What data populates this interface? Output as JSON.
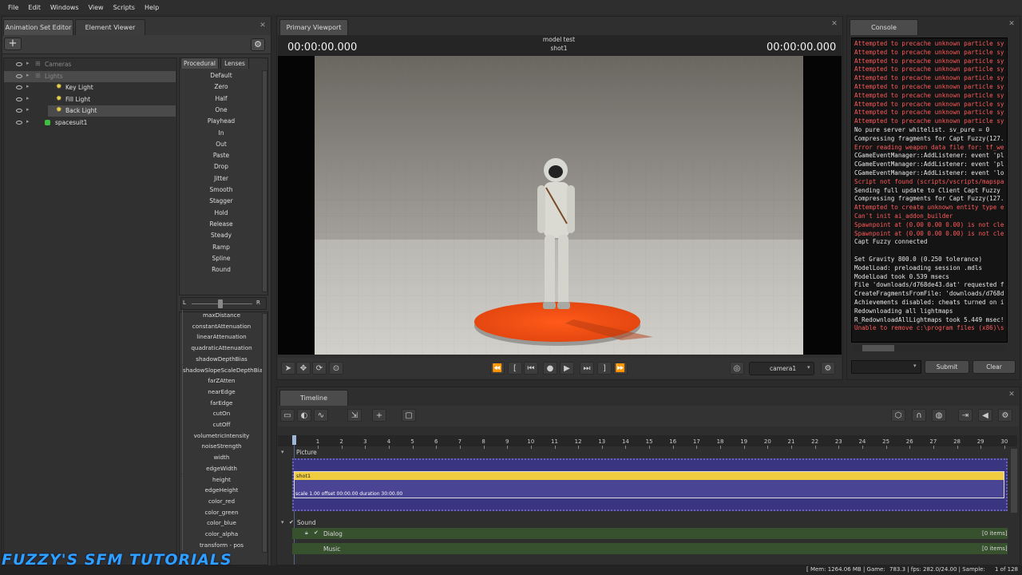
{
  "menu": [
    "File",
    "Edit",
    "Windows",
    "View",
    "Scripts",
    "Help"
  ],
  "left_panel": {
    "tabs": [
      "Animation Set Editor",
      "Element Viewer"
    ],
    "tree": [
      {
        "label": "Cameras",
        "indent": 0,
        "dim": true
      },
      {
        "label": "Lights",
        "indent": 0,
        "dim": true,
        "selected": true
      },
      {
        "label": "Key Light",
        "indent": 1
      },
      {
        "label": "Fill Light",
        "indent": 1
      },
      {
        "label": "Back Light",
        "indent": 1,
        "selected": true
      },
      {
        "label": "spacesuit1",
        "indent": 0
      }
    ],
    "sub_tabs": [
      "Procedural",
      "Lenses"
    ],
    "procedural": [
      "Default",
      "Zero",
      "Half",
      "One",
      "Playhead",
      "In",
      "Out",
      "Paste",
      "Drop",
      "Jitter",
      "Smooth",
      "Stagger",
      "Hold",
      "Release",
      "Steady",
      "Ramp",
      "Spline",
      "Round"
    ],
    "slider_left": "L",
    "slider_right": "R",
    "attributes": [
      "maxDistance",
      "constantAttenuation",
      "linearAttenuation",
      "quadraticAttenuation",
      "shadowDepthBias",
      "shadowSlopeScaleDepthBias",
      "farZAtten",
      "nearEdge",
      "farEdge",
      "cutOn",
      "cutOff",
      "volumetricIntensity",
      "noiseStrength",
      "width",
      "edgeWidth",
      "height",
      "edgeHeight",
      "color_red",
      "color_green",
      "color_blue",
      "color_alpha",
      "transform - pos"
    ]
  },
  "viewport": {
    "tab": "Primary Viewport",
    "time_left": "00:00:00.000",
    "time_right": "00:00:00.000",
    "title": "model test",
    "shot": "shot1",
    "camera": "camera1"
  },
  "console": {
    "tab": "Console",
    "lines": [
      {
        "t": "Attempted to precache unknown particle sy",
        "c": "red"
      },
      {
        "t": "Attempted to precache unknown particle sy",
        "c": "red"
      },
      {
        "t": "Attempted to precache unknown particle sy",
        "c": "red"
      },
      {
        "t": "Attempted to precache unknown particle sy",
        "c": "red"
      },
      {
        "t": "Attempted to precache unknown particle sy",
        "c": "red"
      },
      {
        "t": "Attempted to precache unknown particle sy",
        "c": "red"
      },
      {
        "t": "Attempted to precache unknown particle sy",
        "c": "red"
      },
      {
        "t": "Attempted to precache unknown particle sy",
        "c": "red"
      },
      {
        "t": "Attempted to precache unknown particle sy",
        "c": "red"
      },
      {
        "t": "Attempted to precache unknown particle sy",
        "c": "red"
      },
      {
        "t": "No pure server whitelist. sv_pure = 0",
        "c": "wht"
      },
      {
        "t": "Compressing fragments for Capt Fuzzy(127.",
        "c": "wht"
      },
      {
        "t": "Error reading weapon data file for: tf_we",
        "c": "red"
      },
      {
        "t": "CGameEventManager::AddListener: event 'pl",
        "c": "wht"
      },
      {
        "t": "CGameEventManager::AddListener: event 'pl",
        "c": "wht"
      },
      {
        "t": "CGameEventManager::AddListener: event 'lo",
        "c": "wht"
      },
      {
        "t": "Script not found (scripts/vscripts/mapspa",
        "c": "red"
      },
      {
        "t": "Sending full update to Client Capt Fuzzy",
        "c": "wht"
      },
      {
        "t": "Compressing fragments for Capt Fuzzy(127.",
        "c": "wht"
      },
      {
        "t": "Attempted to create unknown entity type e",
        "c": "red"
      },
      {
        "t": "Can't init ai_addon_builder",
        "c": "red"
      },
      {
        "t": "Spawnpoint at (0.00 0.00 0.00) is not cle",
        "c": "red"
      },
      {
        "t": "Spawnpoint at (0.00 0.00 0.00) is not cle",
        "c": "red"
      },
      {
        "t": "Capt Fuzzy connected",
        "c": "wht"
      },
      {
        "t": "",
        "c": "wht"
      },
      {
        "t": "Set Gravity 800.0 (0.250 tolerance)",
        "c": "wht"
      },
      {
        "t": "ModelLoad:  preloading session .mdls",
        "c": "wht"
      },
      {
        "t": "ModelLoad took 0.539 msecs",
        "c": "wht"
      },
      {
        "t": "File 'downloads/d768de43.dat' requested f",
        "c": "wht"
      },
      {
        "t": "CreateFragmentsFromFile: 'downloads/d768d",
        "c": "wht"
      },
      {
        "t": "Achievements disabled: cheats turned on i",
        "c": "wht"
      },
      {
        "t": "Redownloading all lightmaps",
        "c": "wht"
      },
      {
        "t": "R_RedownloadAllLightmaps took 5.449 msec!",
        "c": "wht"
      },
      {
        "t": "Unable to remove c:\\program files (x86)\\s",
        "c": "red"
      }
    ],
    "submit": "Submit",
    "clear": "Clear"
  },
  "timeline": {
    "tab": "Timeline",
    "ruler": [
      "1",
      "2",
      "3",
      "4",
      "5",
      "6",
      "7",
      "8",
      "9",
      "10",
      "11",
      "12",
      "13",
      "14",
      "15",
      "16",
      "17",
      "18",
      "19",
      "20",
      "21",
      "22",
      "23",
      "24",
      "25",
      "26",
      "27",
      "28",
      "29",
      "30"
    ],
    "picture_label": "Picture",
    "clip_name": "shot1",
    "clip_info": "scale 1.00 offset  00:00.00 duration  30:00.00",
    "sound_label": "Sound",
    "dialog_label": "Dialog",
    "dialog_count": "[0 items]",
    "music_label": "Music",
    "music_count": "[0 items]"
  },
  "status": {
    "mem": "[ Mem: 1264.06 MB | Game:",
    "fps": "783.3 | fps: 282.0/24.00 | Sample:",
    "sample": "1 of 128"
  },
  "watermark": "FUZZY'S SFM TUTORIALS"
}
